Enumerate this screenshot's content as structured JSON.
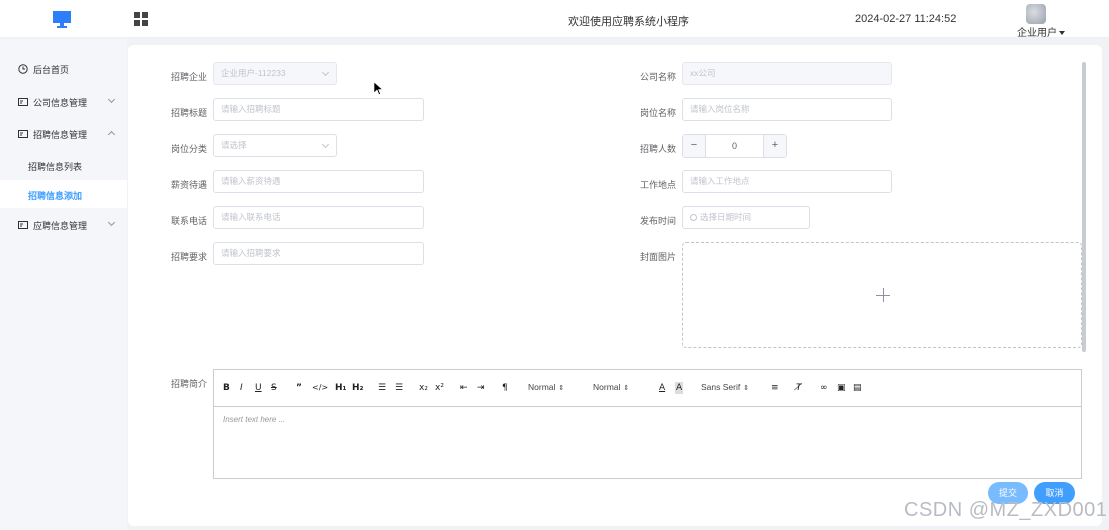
{
  "header": {
    "title": "欢迎使用应聘系统小程序",
    "datetime": "2024-02-27 11:24:52",
    "user_menu": "企业用户"
  },
  "sidebar": {
    "items": [
      {
        "label": "后台首页",
        "icon": "clock-icon"
      },
      {
        "label": "公司信息管理",
        "icon": "card-icon"
      },
      {
        "label": "招聘信息管理",
        "icon": "card-icon"
      },
      {
        "label": "招聘信息列表"
      },
      {
        "label": "招聘信息添加",
        "active": true
      },
      {
        "label": "应聘信息管理",
        "icon": "card-icon"
      }
    ]
  },
  "form": {
    "company_label": "招聘企业",
    "company_value": "企业用户-112233",
    "company_name_label": "公司名称",
    "company_name_placeholder": "xx公司",
    "title_label": "招聘标题",
    "title_placeholder": "请输入招聘标题",
    "position_label": "岗位名称",
    "position_placeholder": "请输入岗位名称",
    "category_label": "岗位分类",
    "category_placeholder": "请选择",
    "headcount_label": "招聘人数",
    "headcount_value": "0",
    "salary_label": "薪资待遇",
    "salary_placeholder": "请输入薪资待遇",
    "location_label": "工作地点",
    "location_placeholder": "请输入工作地点",
    "phone_label": "联系电话",
    "phone_placeholder": "请输入联系电话",
    "publish_label": "发布时间",
    "publish_placeholder": "选择日期时间",
    "requirement_label": "招聘要求",
    "requirement_placeholder": "请输入招聘要求",
    "cover_label": "封面图片",
    "intro_label": "招聘简介"
  },
  "editor": {
    "heading_select": "Normal",
    "size_select": "Normal",
    "font_select": "Sans Serif",
    "placeholder": "Insert text here ..."
  },
  "actions": {
    "submit": "提交",
    "cancel": "取消"
  },
  "watermark": "CSDN @MZ_ZXD001",
  "colors": {
    "primary": "#409eff",
    "primary_light": "#79bbff",
    "logo": "#2d7ff9"
  }
}
